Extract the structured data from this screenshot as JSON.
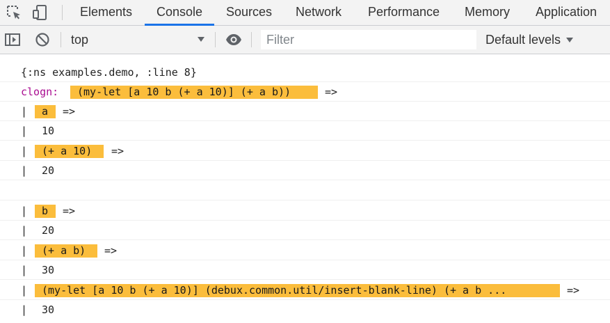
{
  "tabs": [
    {
      "label": "Elements"
    },
    {
      "label": "Console"
    },
    {
      "label": "Sources"
    },
    {
      "label": "Network"
    },
    {
      "label": "Performance"
    },
    {
      "label": "Memory"
    },
    {
      "label": "Application"
    }
  ],
  "active_tab": "Console",
  "icons": {
    "inspect": "element-picker-icon",
    "device": "device-toolbar-icon",
    "sidebar": "show-sidebar-icon",
    "clear": "clear-console-icon",
    "eye": "live-expression-icon"
  },
  "toolbar": {
    "context": "top",
    "filter_placeholder": "Filter",
    "levels": "Default levels"
  },
  "colors": {
    "highlight": "#fbbd3c",
    "clogn_prefix": "#aa0d91",
    "active_tab_underline": "#1a73e8"
  },
  "console": {
    "ns_line": "{:ns examples.demo, :line 8}",
    "clogn_label": "clogn:",
    "form_main": "(my-let [a 10 b (+ a 10)] (+ a b))",
    "arrow": "=>",
    "pipe": "|",
    "entries": [
      {
        "expr": "a",
        "value": "10"
      },
      {
        "expr": "(+ a 10)",
        "value": "20"
      },
      {
        "expr": "b",
        "value": "20"
      },
      {
        "expr": "(+ a b)",
        "value": "30"
      },
      {
        "expr": "(my-let [a 10 b (+ a 10)] (debux.common.util/insert-blank-line) (+ a b ...",
        "value": "30"
      }
    ]
  }
}
